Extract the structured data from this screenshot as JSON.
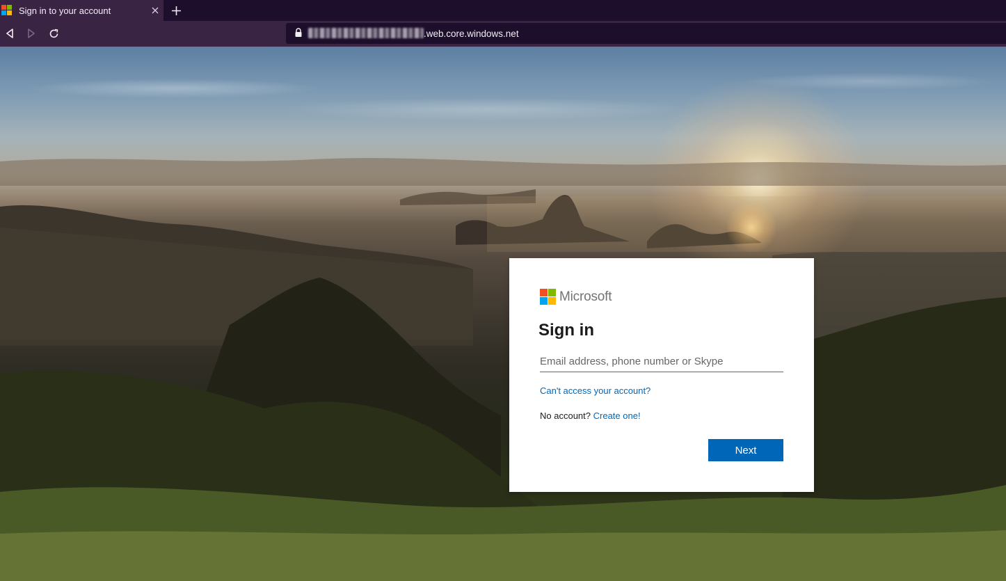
{
  "browser": {
    "tab": {
      "title": "Sign in to your account",
      "favicon": "microsoft-logo-icon",
      "close_icon": "close-icon"
    },
    "new_tab_icon": "plus-icon",
    "nav": {
      "back_icon": "back-arrow-icon",
      "forward_icon": "forward-arrow-icon",
      "reload_icon": "reload-icon"
    },
    "address_bar": {
      "lock_icon": "lock-icon",
      "url_visible": ".web.core.windows.net"
    }
  },
  "signin": {
    "brand": "Microsoft",
    "title": "Sign in",
    "email_placeholder": "Email address, phone number or Skype",
    "email_value": "",
    "cant_access_link": "Can't access your account?",
    "no_account_text": "No account?",
    "create_link": "Create one!",
    "next_button": "Next"
  },
  "colors": {
    "accent": "#0067b8",
    "logo_red": "#f25022",
    "logo_green": "#7fba00",
    "logo_blue": "#00a4ef",
    "logo_yellow": "#ffb900",
    "chrome_dark": "#1d0f2b",
    "chrome_tab": "#3a2443"
  }
}
